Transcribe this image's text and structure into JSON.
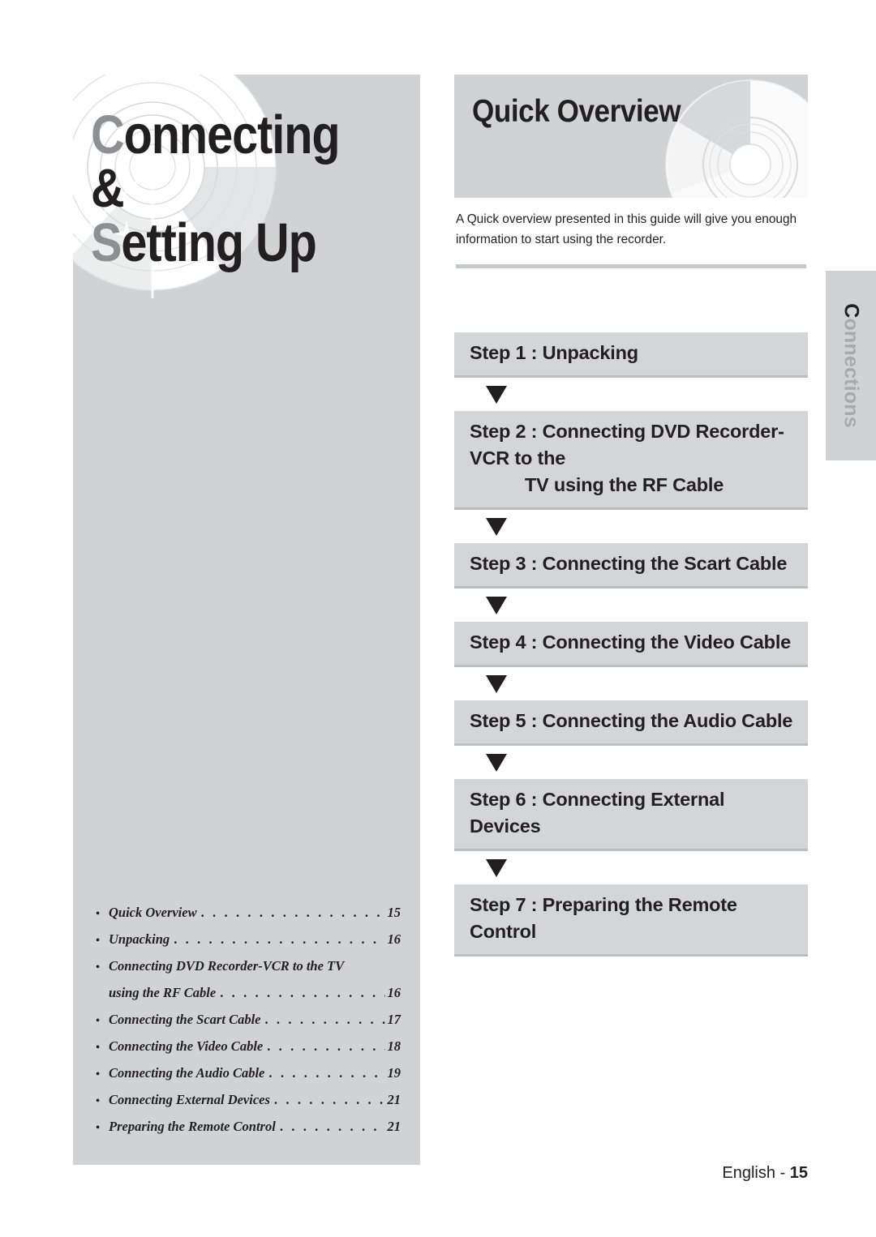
{
  "chapter": {
    "title_line1": "Connecting &",
    "title_line2": "Setting Up",
    "title_lead1": "C",
    "title_rest1": "onnecting &",
    "title_lead2": "S",
    "title_rest2": "etting Up"
  },
  "overview": {
    "heading": "Quick Overview",
    "intro": "A Quick overview presented in this guide will give you enough information to start using the recorder."
  },
  "steps": [
    {
      "label": "Step 1 : Unpacking",
      "line2": ""
    },
    {
      "label": "Step 2 : Connecting DVD Recorder-VCR to the",
      "line2": "TV using the RF Cable"
    },
    {
      "label": "Step 3 : Connecting the Scart Cable",
      "line2": ""
    },
    {
      "label": "Step 4 : Connecting the Video Cable",
      "line2": ""
    },
    {
      "label": "Step 5 : Connecting the Audio Cable",
      "line2": ""
    },
    {
      "label": "Step 6 : Connecting External Devices",
      "line2": ""
    },
    {
      "label": "Step 7 : Preparing the Remote Control",
      "line2": ""
    }
  ],
  "toc": {
    "bullet": "•",
    "leader": ". . . . . . . . . . . . . . . . . . . . . . . . . . . . . . . .",
    "items": [
      {
        "label": "Quick Overview",
        "page": "15",
        "continuation": false,
        "has_leader": true,
        "has_page": true
      },
      {
        "label": "Unpacking",
        "page": "16",
        "continuation": false,
        "has_leader": true,
        "has_page": true
      },
      {
        "label": "Connecting DVD Recorder-VCR to the TV",
        "page": "",
        "continuation": false,
        "has_leader": false,
        "has_page": false
      },
      {
        "label": "using the RF Cable",
        "page": "16",
        "continuation": true,
        "has_leader": true,
        "has_page": true
      },
      {
        "label": "Connecting the Scart Cable",
        "page": "17",
        "continuation": false,
        "has_leader": true,
        "has_page": true
      },
      {
        "label": "Connecting the Video Cable",
        "page": "18",
        "continuation": false,
        "has_leader": true,
        "has_page": true
      },
      {
        "label": "Connecting the Audio Cable",
        "page": "19",
        "continuation": false,
        "has_leader": true,
        "has_page": true
      },
      {
        "label": "Connecting External Devices",
        "page": "21",
        "continuation": false,
        "has_leader": true,
        "has_page": true
      },
      {
        "label": "Preparing the Remote Control",
        "page": "21",
        "continuation": false,
        "has_leader": true,
        "has_page": true
      }
    ]
  },
  "side_tab": {
    "text": "Connections",
    "lead_letter": "C",
    "rest": "onnections"
  },
  "footer": {
    "language": "English - ",
    "page_number": "15"
  },
  "colors": {
    "panel_grey": "#d1d2d4",
    "step_grey": "#d4d5d7",
    "step_shadow": "#bdbec0",
    "rule_grey": "#c7c8ca",
    "ink": "#231f20",
    "dim_ink": "#8d8f92",
    "tab_text_grey": "#a7a9ac"
  }
}
